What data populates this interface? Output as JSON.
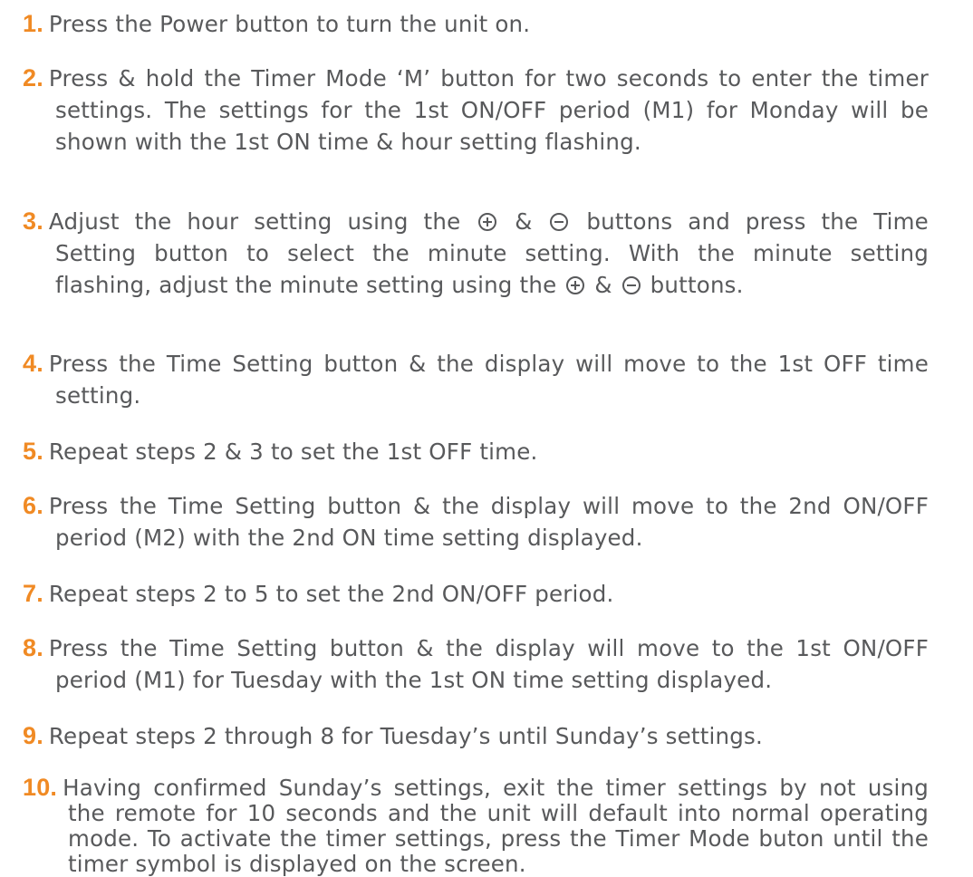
{
  "steps": [
    {
      "num": "1.",
      "lines": [
        "Press the Power button to turn the unit on."
      ]
    },
    {
      "num": "2.",
      "lines": [
        "Press & hold the Timer Mode ‘M’ button for two seconds to enter the timer",
        "settings. The settings for the 1st ON/OFF period (M1) for Monday will be",
        "shown with the 1st ON time & hour setting flashing."
      ]
    },
    {
      "num": "3.",
      "lines": [
        "Adjust the hour setting using the",
        "&",
        "buttons and press the Time",
        "Setting button to select the minute setting. With the minute setting",
        "flashing, adjust the minute setting using the",
        "&",
        "buttons."
      ]
    },
    {
      "num": "4.",
      "lines": [
        "Press the Time Setting button & the display will move to the 1st OFF time",
        "setting."
      ]
    },
    {
      "num": "5.",
      "lines": [
        "Repeat steps 2 & 3 to set the 1st OFF time."
      ]
    },
    {
      "num": "6.",
      "lines": [
        "Press the Time Setting button & the display will move to the 2nd ON/OFF",
        "period (M2) with the 2nd ON time setting displayed."
      ]
    },
    {
      "num": "7.",
      "lines": [
        "Repeat steps 2 to 5 to set the 2nd ON/OFF period."
      ]
    },
    {
      "num": "8.",
      "lines": [
        "Press the Time Setting button & the display will move to the 1st ON/OFF",
        "period (M1) for Tuesday with the 1st ON time setting displayed."
      ]
    },
    {
      "num": "9.",
      "lines": [
        "Repeat steps 2 through 8 for Tuesday’s until  Sunday’s settings."
      ]
    },
    {
      "num": "10.",
      "lines": [
        "Having confirmed Sunday’s settings, exit the timer settings by not using",
        "the remote for 10 seconds and the unit will default into normal operating",
        "mode. To activate the timer settings, press the Timer Mode buton until the",
        "timer symbol is displayed on the screen."
      ]
    }
  ],
  "icons": {
    "plus": "plus-circle-icon",
    "minus": "minus-circle-icon"
  },
  "colors": {
    "accent": "#f08a24",
    "text": "#58595b"
  }
}
